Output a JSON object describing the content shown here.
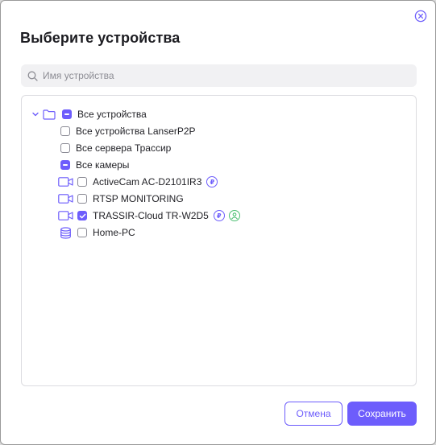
{
  "dialog": {
    "title": "Выберите устройства",
    "close_icon": "close-circle-icon"
  },
  "search": {
    "placeholder": "Имя устройства",
    "value": "",
    "icon": "search-icon"
  },
  "tree": {
    "root": {
      "label": "Все устройства",
      "state": "partial",
      "expanded": true,
      "icon": "folder-icon"
    },
    "items": [
      {
        "label": "Все устройства LanserP2P",
        "state": "unchecked"
      },
      {
        "label": "Все сервера Трассир",
        "state": "unchecked"
      },
      {
        "label": "Все камеры",
        "state": "partial"
      },
      {
        "label": "ActiveCam AC-D2101IR3",
        "state": "unchecked",
        "icon": "camera-icon",
        "badges": [
          "ruble-icon"
        ]
      },
      {
        "label": "RTSP MONITORING",
        "state": "unchecked",
        "icon": "camera-icon",
        "badges": []
      },
      {
        "label": "TRASSIR-Cloud TR-W2D5",
        "state": "checked",
        "icon": "camera-icon",
        "badges": [
          "ruble-icon",
          "user-icon"
        ]
      },
      {
        "label": "Home-PC",
        "state": "unchecked",
        "icon": "database-icon",
        "badges": []
      }
    ]
  },
  "buttons": {
    "cancel_label": "Отмена",
    "save_label": "Сохранить"
  },
  "colors": {
    "accent": "#6d5dfc",
    "badge_green": "#4cbf72",
    "border": "#dcdce0"
  }
}
